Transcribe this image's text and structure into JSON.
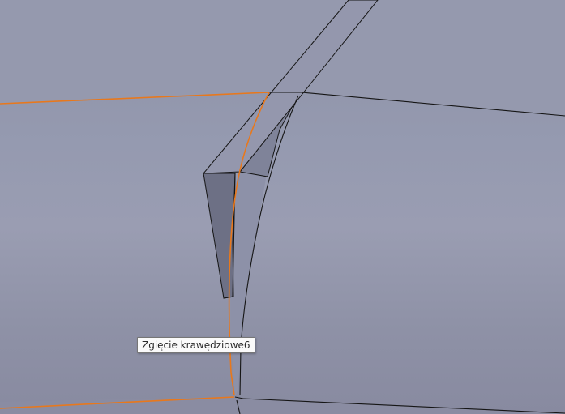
{
  "viewport": {
    "tooltip_text": "Zgięcie krawędziowe6"
  },
  "colors": {
    "background_top": "#8e91a6",
    "background_mid": "#9a9db2",
    "edge_line": "#111111",
    "selected_edge": "#e8781c",
    "flange_side_face": "#6c6f84",
    "flange_inner_face": "#858aa2",
    "tooltip_background": "#fafafa"
  }
}
